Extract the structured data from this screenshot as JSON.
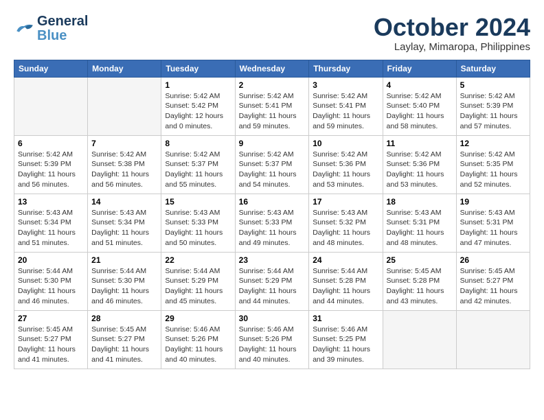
{
  "header": {
    "logo_line1": "General",
    "logo_line2": "Blue",
    "month_title": "October 2024",
    "location": "Laylay, Mimaropa, Philippines"
  },
  "weekdays": [
    "Sunday",
    "Monday",
    "Tuesday",
    "Wednesday",
    "Thursday",
    "Friday",
    "Saturday"
  ],
  "weeks": [
    [
      {
        "day": "",
        "info": ""
      },
      {
        "day": "",
        "info": ""
      },
      {
        "day": "1",
        "info": "Sunrise: 5:42 AM\nSunset: 5:42 PM\nDaylight: 12 hours\nand 0 minutes."
      },
      {
        "day": "2",
        "info": "Sunrise: 5:42 AM\nSunset: 5:41 PM\nDaylight: 11 hours\nand 59 minutes."
      },
      {
        "day": "3",
        "info": "Sunrise: 5:42 AM\nSunset: 5:41 PM\nDaylight: 11 hours\nand 59 minutes."
      },
      {
        "day": "4",
        "info": "Sunrise: 5:42 AM\nSunset: 5:40 PM\nDaylight: 11 hours\nand 58 minutes."
      },
      {
        "day": "5",
        "info": "Sunrise: 5:42 AM\nSunset: 5:39 PM\nDaylight: 11 hours\nand 57 minutes."
      }
    ],
    [
      {
        "day": "6",
        "info": "Sunrise: 5:42 AM\nSunset: 5:39 PM\nDaylight: 11 hours\nand 56 minutes."
      },
      {
        "day": "7",
        "info": "Sunrise: 5:42 AM\nSunset: 5:38 PM\nDaylight: 11 hours\nand 56 minutes."
      },
      {
        "day": "8",
        "info": "Sunrise: 5:42 AM\nSunset: 5:37 PM\nDaylight: 11 hours\nand 55 minutes."
      },
      {
        "day": "9",
        "info": "Sunrise: 5:42 AM\nSunset: 5:37 PM\nDaylight: 11 hours\nand 54 minutes."
      },
      {
        "day": "10",
        "info": "Sunrise: 5:42 AM\nSunset: 5:36 PM\nDaylight: 11 hours\nand 53 minutes."
      },
      {
        "day": "11",
        "info": "Sunrise: 5:42 AM\nSunset: 5:36 PM\nDaylight: 11 hours\nand 53 minutes."
      },
      {
        "day": "12",
        "info": "Sunrise: 5:42 AM\nSunset: 5:35 PM\nDaylight: 11 hours\nand 52 minutes."
      }
    ],
    [
      {
        "day": "13",
        "info": "Sunrise: 5:43 AM\nSunset: 5:34 PM\nDaylight: 11 hours\nand 51 minutes."
      },
      {
        "day": "14",
        "info": "Sunrise: 5:43 AM\nSunset: 5:34 PM\nDaylight: 11 hours\nand 51 minutes."
      },
      {
        "day": "15",
        "info": "Sunrise: 5:43 AM\nSunset: 5:33 PM\nDaylight: 11 hours\nand 50 minutes."
      },
      {
        "day": "16",
        "info": "Sunrise: 5:43 AM\nSunset: 5:33 PM\nDaylight: 11 hours\nand 49 minutes."
      },
      {
        "day": "17",
        "info": "Sunrise: 5:43 AM\nSunset: 5:32 PM\nDaylight: 11 hours\nand 48 minutes."
      },
      {
        "day": "18",
        "info": "Sunrise: 5:43 AM\nSunset: 5:31 PM\nDaylight: 11 hours\nand 48 minutes."
      },
      {
        "day": "19",
        "info": "Sunrise: 5:43 AM\nSunset: 5:31 PM\nDaylight: 11 hours\nand 47 minutes."
      }
    ],
    [
      {
        "day": "20",
        "info": "Sunrise: 5:44 AM\nSunset: 5:30 PM\nDaylight: 11 hours\nand 46 minutes."
      },
      {
        "day": "21",
        "info": "Sunrise: 5:44 AM\nSunset: 5:30 PM\nDaylight: 11 hours\nand 46 minutes."
      },
      {
        "day": "22",
        "info": "Sunrise: 5:44 AM\nSunset: 5:29 PM\nDaylight: 11 hours\nand 45 minutes."
      },
      {
        "day": "23",
        "info": "Sunrise: 5:44 AM\nSunset: 5:29 PM\nDaylight: 11 hours\nand 44 minutes."
      },
      {
        "day": "24",
        "info": "Sunrise: 5:44 AM\nSunset: 5:28 PM\nDaylight: 11 hours\nand 44 minutes."
      },
      {
        "day": "25",
        "info": "Sunrise: 5:45 AM\nSunset: 5:28 PM\nDaylight: 11 hours\nand 43 minutes."
      },
      {
        "day": "26",
        "info": "Sunrise: 5:45 AM\nSunset: 5:27 PM\nDaylight: 11 hours\nand 42 minutes."
      }
    ],
    [
      {
        "day": "27",
        "info": "Sunrise: 5:45 AM\nSunset: 5:27 PM\nDaylight: 11 hours\nand 41 minutes."
      },
      {
        "day": "28",
        "info": "Sunrise: 5:45 AM\nSunset: 5:27 PM\nDaylight: 11 hours\nand 41 minutes."
      },
      {
        "day": "29",
        "info": "Sunrise: 5:46 AM\nSunset: 5:26 PM\nDaylight: 11 hours\nand 40 minutes."
      },
      {
        "day": "30",
        "info": "Sunrise: 5:46 AM\nSunset: 5:26 PM\nDaylight: 11 hours\nand 40 minutes."
      },
      {
        "day": "31",
        "info": "Sunrise: 5:46 AM\nSunset: 5:25 PM\nDaylight: 11 hours\nand 39 minutes."
      },
      {
        "day": "",
        "info": ""
      },
      {
        "day": "",
        "info": ""
      }
    ]
  ]
}
